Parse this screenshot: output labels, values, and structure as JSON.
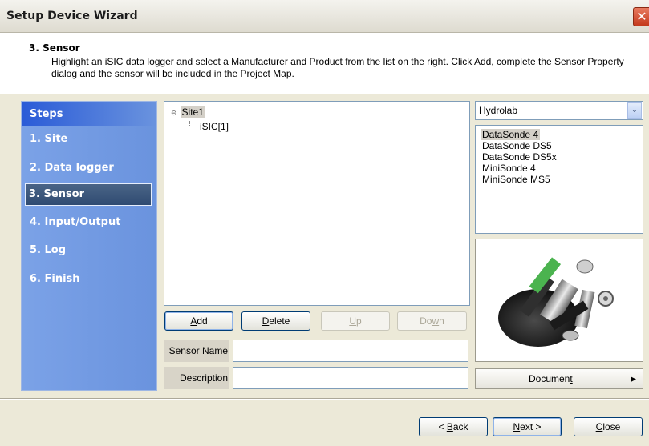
{
  "window": {
    "title": "Setup Device Wizard",
    "close_glyph": "✕"
  },
  "header": {
    "step_title": "3. Sensor",
    "description": "Highlight an iSIC data logger and select a Manufacturer and Product from the list on the right. Click Add, complete the Sensor Property dialog and the sensor will be included in the Project Map."
  },
  "steps": {
    "heading": "Steps",
    "items": [
      {
        "label": "1. Site"
      },
      {
        "label": "2. Data logger"
      },
      {
        "label": "3. Sensor",
        "active": true
      },
      {
        "label": "4. Input/Output"
      },
      {
        "label": "5. Log"
      },
      {
        "label": "6. Finish"
      }
    ]
  },
  "tree": {
    "root": "Site1",
    "expander": "⊖",
    "child": "iSIC[1]"
  },
  "buttons": {
    "add": {
      "mnemonic": "A",
      "rest": "dd"
    },
    "delete": {
      "mnemonic": "D",
      "rest": "elete"
    },
    "up": {
      "mnemonic": "U",
      "rest": "p"
    },
    "down": {
      "pre": "Do",
      "mnemonic": "w",
      "rest": "n"
    }
  },
  "fields": {
    "sensor_name_label": "Sensor Name",
    "sensor_name_value": "",
    "description_label": "Description",
    "description_value": ""
  },
  "manufacturer": {
    "selected": "Hydrolab",
    "arrow": "⌄"
  },
  "products": {
    "items": [
      "DataSonde 4",
      "DataSonde DS5",
      "DataSonde DS5x",
      "MiniSonde 4",
      "MiniSonde MS5"
    ],
    "selected_index": 0
  },
  "document_button": {
    "pre": "Documen",
    "mnemonic": "t",
    "arrow": "▶"
  },
  "footer": {
    "back": {
      "pre": "< ",
      "mnemonic": "B",
      "rest": "ack"
    },
    "next": {
      "mnemonic": "N",
      "rest": "ext >"
    },
    "close": {
      "mnemonic": "C",
      "rest": "lose"
    }
  },
  "colors": {
    "steps_panel": "#6a93de",
    "steps_header": "#2a5bd7",
    "active_step": "#2f4b72",
    "selection": "#d4d0c8"
  },
  "icons": {
    "product_image": "sensor-probe-image",
    "close": "close-icon",
    "dropdown": "chevron-down-icon",
    "document_arrow": "triangle-right-icon"
  }
}
